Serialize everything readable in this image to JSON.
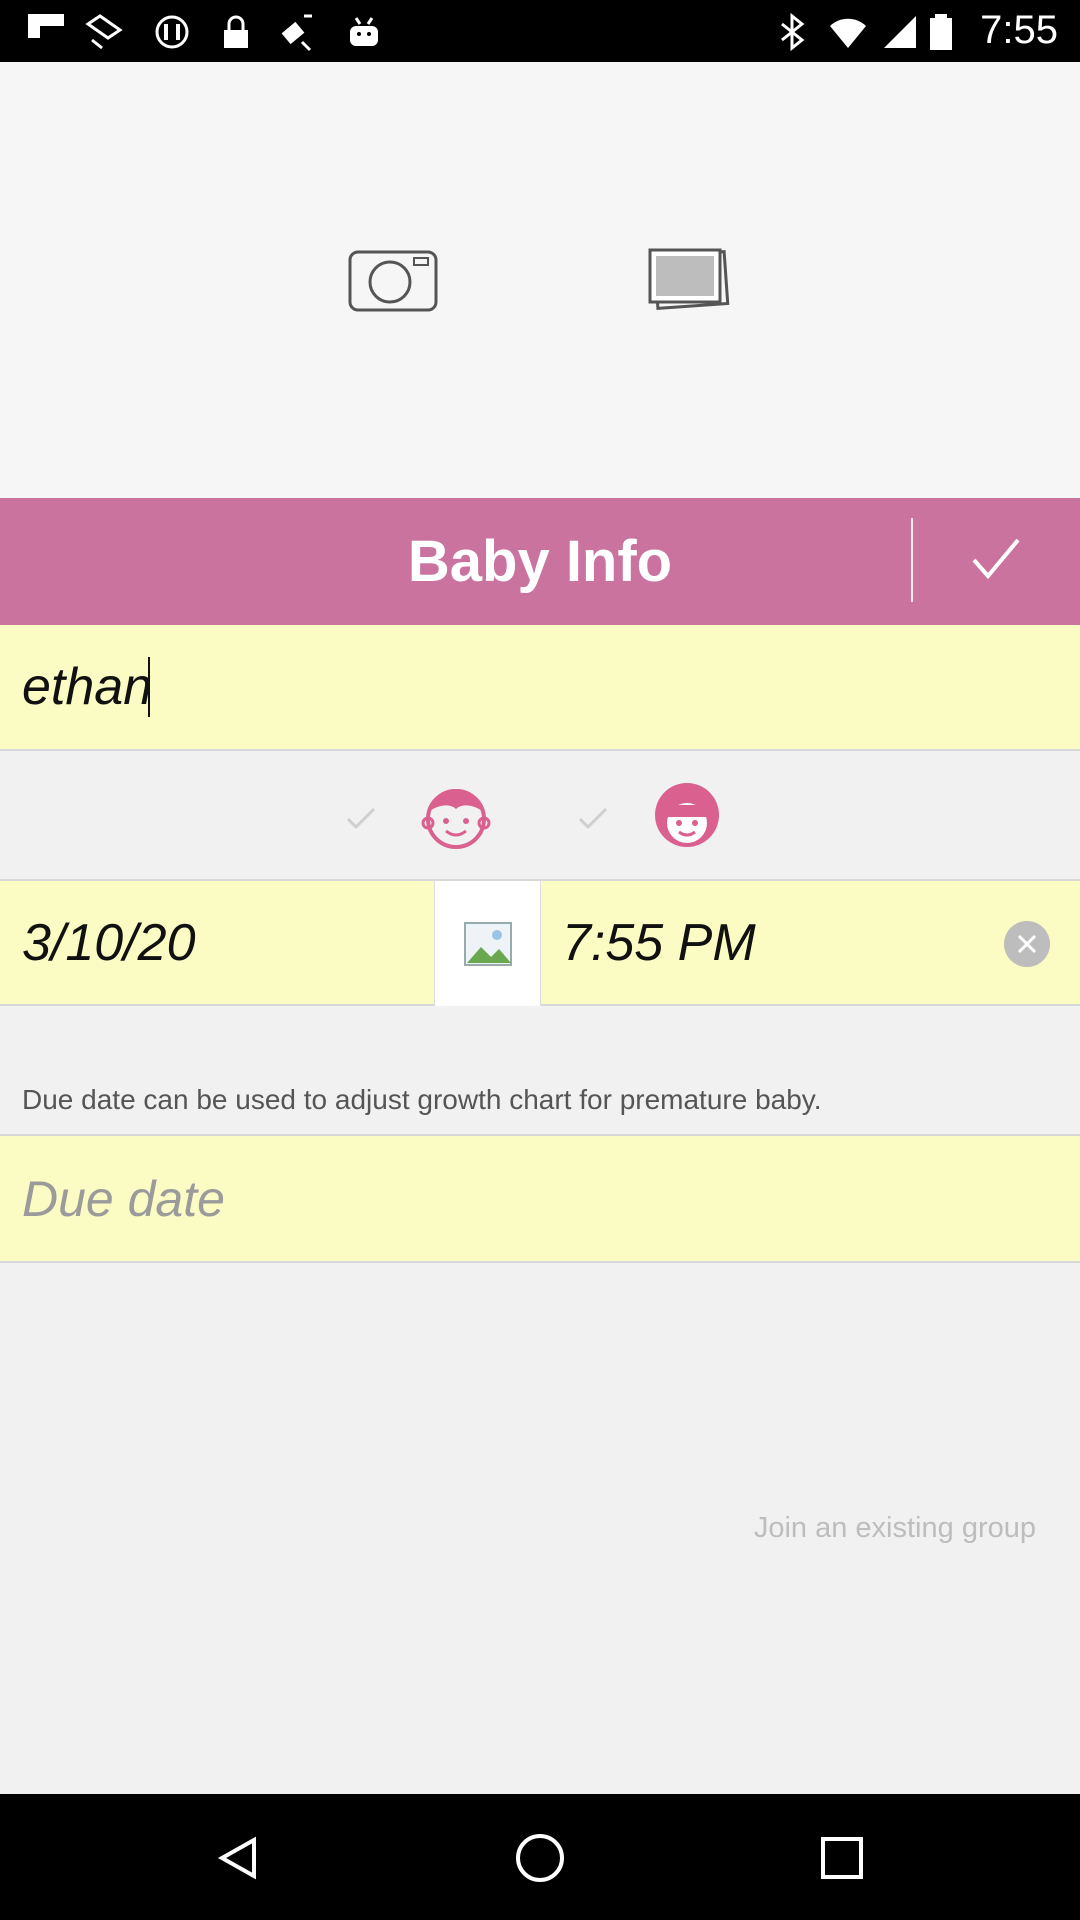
{
  "status_bar": {
    "time": "7:55",
    "icons": [
      "flipboard-icon",
      "photo-icon",
      "sync-icon",
      "lock-icon",
      "fake-gps-icon",
      "android-icon",
      "bluetooth-icon",
      "wifi-icon",
      "signal-icon",
      "battery-icon"
    ]
  },
  "photo": {
    "camera_icon": "camera-icon",
    "gallery_icon": "gallery-icon"
  },
  "header": {
    "title": "Baby Info",
    "confirm_icon": "check-icon",
    "color": "#c9739e"
  },
  "form": {
    "name_value": "ethan",
    "gender": {
      "boy_icon": "boy-face-icon",
      "girl_icon": "girl-face-icon",
      "face_color": "#d9608f"
    },
    "birth_date": "3/10/20",
    "birth_time": "7:55 PM",
    "note": "Due date can be used to adjust growth chart for premature baby.",
    "due_date_placeholder": "Due date",
    "field_color": "#fbfbc4"
  },
  "join_link": "Join an existing group",
  "nav": {
    "back_icon": "back-icon",
    "home_icon": "home-icon",
    "recents_icon": "recents-icon"
  }
}
